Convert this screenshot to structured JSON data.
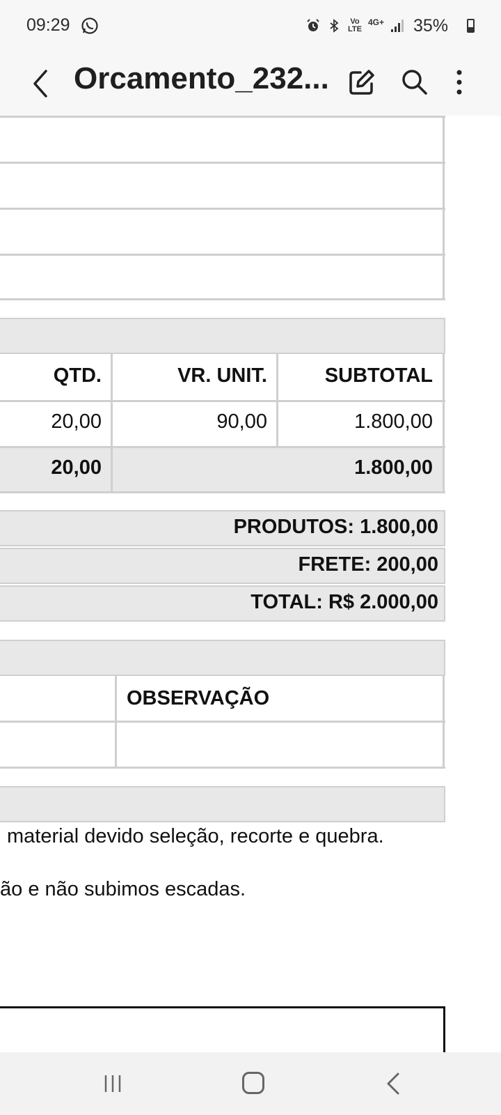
{
  "status_bar": {
    "time": "09:29",
    "battery": "35%",
    "icons": [
      "whatsapp-icon",
      "alarm-icon",
      "bluetooth-icon",
      "volte-icon",
      "4g-icon",
      "signal-icon",
      "battery-icon"
    ],
    "volte_text": "Vo LTE",
    "network_text": "4G+"
  },
  "app_bar": {
    "title": "Orcamento_232...",
    "icons": [
      "back-icon",
      "edit-icon",
      "search-icon",
      "more-icon"
    ]
  },
  "items_table": {
    "headers": [
      "QTD.",
      "VR. UNIT.",
      "SUBTOTAL"
    ],
    "rows": [
      {
        "qtd": "20,00",
        "vr_unit": "90,00",
        "subtotal": "1.800,00"
      }
    ],
    "totals": {
      "qtd": "20,00",
      "subtotal": "1.800,00"
    }
  },
  "summary": {
    "produtos": "PRODUTOS: 1.800,00",
    "frete": "FRETE: 200,00",
    "total": "TOTAL: R$ 2.000,00"
  },
  "observacao": {
    "header": "OBSERVAÇÃO"
  },
  "notes": [
    "material devido seleção, recorte e quebra.",
    "ão e não subimos escadas."
  ],
  "nav_bar": {
    "icons": [
      "recent-apps-icon",
      "home-icon",
      "back-icon"
    ]
  },
  "colors": {
    "status_bar_bg": "#f7f7f7",
    "header_gray": "#e8e8e8",
    "border": "#cfcfcf",
    "nav_bar_bg": "#f2f2f2"
  }
}
